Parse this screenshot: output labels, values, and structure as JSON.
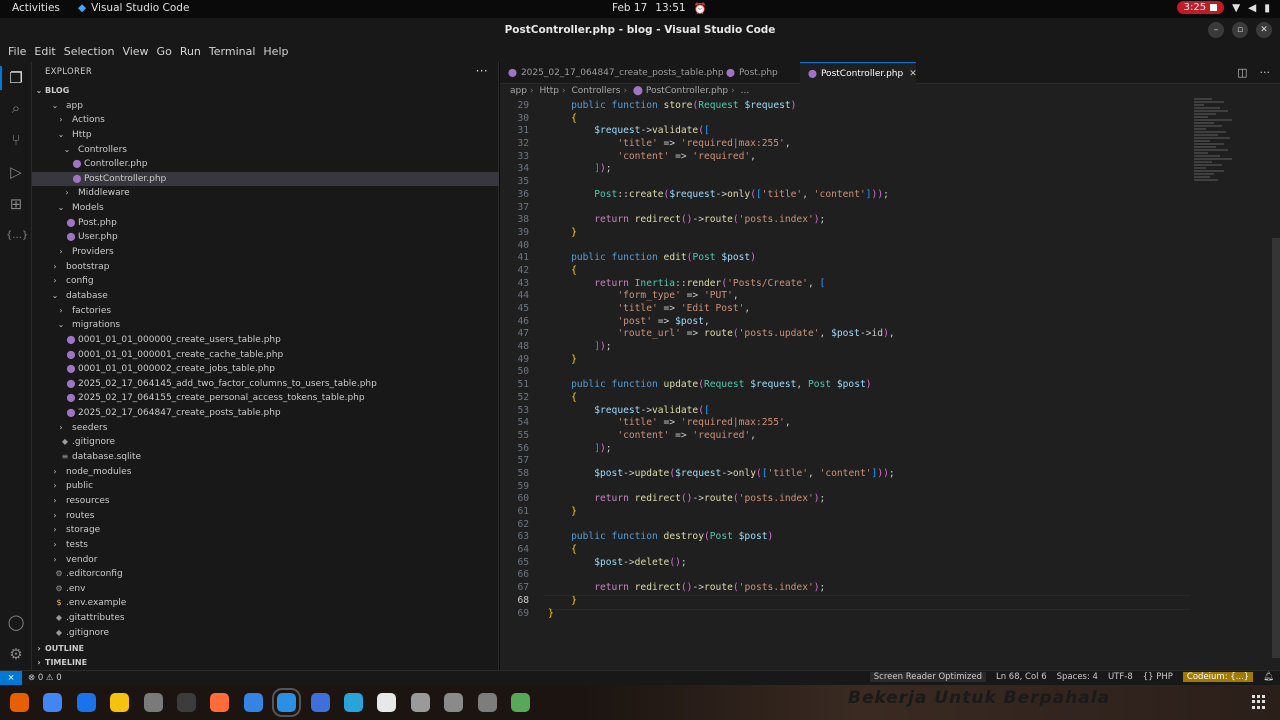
{
  "topbar": {
    "activities": "Activities",
    "app_name": "Visual Studio Code",
    "date": "Feb 17",
    "time": "13:51",
    "recording_time": "3:25"
  },
  "window": {
    "title": "PostController.php - blog - Visual Studio Code"
  },
  "menu": [
    "File",
    "Edit",
    "Selection",
    "View",
    "Go",
    "Run",
    "Terminal",
    "Help"
  ],
  "sidebar": {
    "title": "EXPLORER",
    "root": "BLOG",
    "tree": [
      {
        "label": "app",
        "depth": 1,
        "type": "folder-open"
      },
      {
        "label": "Actions",
        "depth": 2,
        "type": "folder"
      },
      {
        "label": "Http",
        "depth": 2,
        "type": "folder-open"
      },
      {
        "label": "Controllers",
        "depth": 3,
        "type": "folder-open"
      },
      {
        "label": "Controller.php",
        "depth": 4,
        "type": "php"
      },
      {
        "label": "PostController.php",
        "depth": 4,
        "type": "php",
        "selected": true
      },
      {
        "label": "Middleware",
        "depth": 3,
        "type": "folder"
      },
      {
        "label": "Models",
        "depth": 2,
        "type": "folder-open"
      },
      {
        "label": "Post.php",
        "depth": 3,
        "type": "php"
      },
      {
        "label": "User.php",
        "depth": 3,
        "type": "php"
      },
      {
        "label": "Providers",
        "depth": 2,
        "type": "folder"
      },
      {
        "label": "bootstrap",
        "depth": 1,
        "type": "folder"
      },
      {
        "label": "config",
        "depth": 1,
        "type": "folder"
      },
      {
        "label": "database",
        "depth": 1,
        "type": "folder-open"
      },
      {
        "label": "factories",
        "depth": 2,
        "type": "folder"
      },
      {
        "label": "migrations",
        "depth": 2,
        "type": "folder-open"
      },
      {
        "label": "0001_01_01_000000_create_users_table.php",
        "depth": 3,
        "type": "php"
      },
      {
        "label": "0001_01_01_000001_create_cache_table.php",
        "depth": 3,
        "type": "php"
      },
      {
        "label": "0001_01_01_000002_create_jobs_table.php",
        "depth": 3,
        "type": "php"
      },
      {
        "label": "2025_02_17_064145_add_two_factor_columns_to_users_table.php",
        "depth": 3,
        "type": "php"
      },
      {
        "label": "2025_02_17_064155_create_personal_access_tokens_table.php",
        "depth": 3,
        "type": "php"
      },
      {
        "label": "2025_02_17_064847_create_posts_table.php",
        "depth": 3,
        "type": "php"
      },
      {
        "label": "seeders",
        "depth": 2,
        "type": "folder"
      },
      {
        "label": ".gitignore",
        "depth": 2,
        "type": "git"
      },
      {
        "label": "database.sqlite",
        "depth": 2,
        "type": "db"
      },
      {
        "label": "node_modules",
        "depth": 1,
        "type": "folder"
      },
      {
        "label": "public",
        "depth": 1,
        "type": "folder"
      },
      {
        "label": "resources",
        "depth": 1,
        "type": "folder"
      },
      {
        "label": "routes",
        "depth": 1,
        "type": "folder"
      },
      {
        "label": "storage",
        "depth": 1,
        "type": "folder"
      },
      {
        "label": "tests",
        "depth": 1,
        "type": "folder"
      },
      {
        "label": "vendor",
        "depth": 1,
        "type": "folder"
      },
      {
        "label": ".editorconfig",
        "depth": 1,
        "type": "gear"
      },
      {
        "label": ".env",
        "depth": 1,
        "type": "gear"
      },
      {
        "label": ".env.example",
        "depth": 1,
        "type": "dollar"
      },
      {
        "label": ".gitattributes",
        "depth": 1,
        "type": "git"
      },
      {
        "label": ".gitignore",
        "depth": 1,
        "type": "git"
      }
    ],
    "outline": "OUTLINE",
    "timeline": "TIMELINE"
  },
  "tabs": [
    {
      "label": "2025_02_17_064847_create_posts_table.php",
      "active": false
    },
    {
      "label": "Post.php",
      "active": false
    },
    {
      "label": "PostController.php",
      "active": true
    }
  ],
  "breadcrumb": [
    "app",
    "Http",
    "Controllers",
    "PostController.php",
    "..."
  ],
  "code": [
    {
      "n": 29,
      "t": "    public function store(Request $request)"
    },
    {
      "n": 30,
      "t": "    {"
    },
    {
      "n": 31,
      "t": "        $request->validate(["
    },
    {
      "n": 32,
      "t": "            'title' => 'required|max:255',"
    },
    {
      "n": 33,
      "t": "            'content' => 'required',"
    },
    {
      "n": 34,
      "t": "        ]);"
    },
    {
      "n": 35,
      "t": ""
    },
    {
      "n": 36,
      "t": "        Post::create($request->only(['title', 'content']));"
    },
    {
      "n": 37,
      "t": ""
    },
    {
      "n": 38,
      "t": "        return redirect()->route('posts.index');"
    },
    {
      "n": 39,
      "t": "    }"
    },
    {
      "n": 40,
      "t": ""
    },
    {
      "n": 41,
      "t": "    public function edit(Post $post)"
    },
    {
      "n": 42,
      "t": "    {"
    },
    {
      "n": 43,
      "t": "        return Inertia::render('Posts/Create', ["
    },
    {
      "n": 44,
      "t": "            'form_type' => 'PUT',"
    },
    {
      "n": 45,
      "t": "            'title' => 'Edit Post',"
    },
    {
      "n": 46,
      "t": "            'post' => $post,"
    },
    {
      "n": 47,
      "t": "            'route_url' => route('posts.update', $post->id),"
    },
    {
      "n": 48,
      "t": "        ]);"
    },
    {
      "n": 49,
      "t": "    }"
    },
    {
      "n": 50,
      "t": ""
    },
    {
      "n": 51,
      "t": "    public function update(Request $request, Post $post)"
    },
    {
      "n": 52,
      "t": "    {"
    },
    {
      "n": 53,
      "t": "        $request->validate(["
    },
    {
      "n": 54,
      "t": "            'title' => 'required|max:255',"
    },
    {
      "n": 55,
      "t": "            'content' => 'required',"
    },
    {
      "n": 56,
      "t": "        ]);"
    },
    {
      "n": 57,
      "t": ""
    },
    {
      "n": 58,
      "t": "        $post->update($request->only(['title', 'content']));"
    },
    {
      "n": 59,
      "t": ""
    },
    {
      "n": 60,
      "t": "        return redirect()->route('posts.index');"
    },
    {
      "n": 61,
      "t": "    }"
    },
    {
      "n": 62,
      "t": ""
    },
    {
      "n": 63,
      "t": "    public function destroy(Post $post)"
    },
    {
      "n": 64,
      "t": "    {"
    },
    {
      "n": 65,
      "t": "        $post->delete();"
    },
    {
      "n": 66,
      "t": ""
    },
    {
      "n": 67,
      "t": "        return redirect()->route('posts.index');"
    },
    {
      "n": 68,
      "t": "    }",
      "current": true
    },
    {
      "n": 69,
      "t": "}"
    }
  ],
  "statusbar": {
    "problems": "⊗ 0 ⚠ 0",
    "screen_reader": "Screen Reader Optimized",
    "position": "Ln 68, Col 6",
    "spaces": "Spaces: 4",
    "encoding": "UTF-8",
    "language": "PHP",
    "codeium": "Codeium: {...}"
  },
  "dock": {
    "apps": [
      "firefox-icon",
      "chrome-icon",
      "thunderbird-icon",
      "rhythmbox-icon",
      "files-icon",
      "terminal-icon",
      "postman-icon",
      "text-editor-icon",
      "vscode-icon",
      "cloud-app-icon",
      "telegram-icon",
      "app-center-icon",
      "trash-placeholder-icon",
      "notes-placeholder-icon",
      "window-placeholder-icon",
      "recycle-icon"
    ],
    "wallpaper_text": "Bekerja Untuk Berpahala"
  },
  "colors": {
    "accent": "#0078d4",
    "keyword": "#569cd6",
    "function": "#dcdcaa",
    "variable": "#9cdcfe",
    "string": "#ce9178",
    "class": "#4ec9b0",
    "php_icon": "#a074c4"
  }
}
